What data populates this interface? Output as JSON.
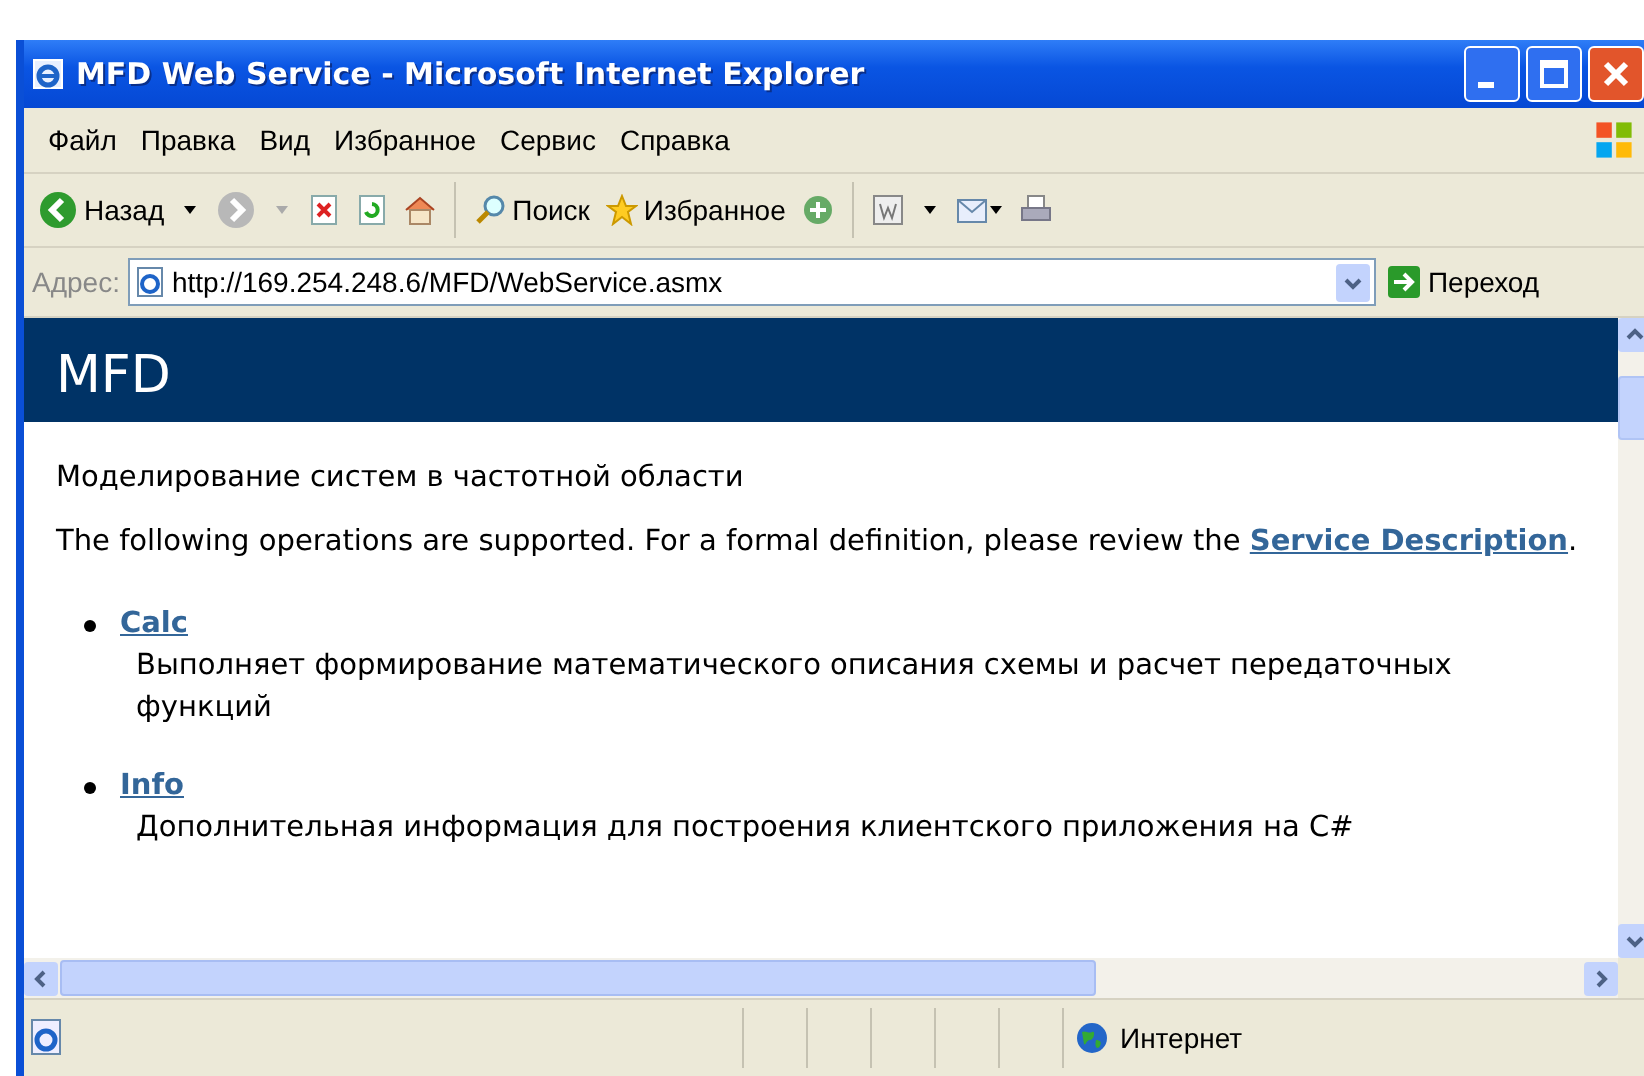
{
  "window": {
    "title": "MFD Web Service - Microsoft Internet Explorer"
  },
  "menu": [
    "Файл",
    "Правка",
    "Вид",
    "Избранное",
    "Сервис",
    "Справка"
  ],
  "toolbar": {
    "back": "Назад",
    "search": "Поиск",
    "favorites": "Избранное"
  },
  "address": {
    "label": "Адрес:",
    "value": "http://169.254.248.6/MFD/WebService.asmx",
    "go": "Переход"
  },
  "page": {
    "heading": "MFD",
    "description": "Моделирование систем в частотной области",
    "intro": "The following operations are supported. For a formal definition, please review the ",
    "intro_link": "Service Description",
    "intro_end": ".",
    "operations": [
      {
        "name": "Calc",
        "description": "Выполняет формирование математического описания схемы и расчет передаточных функций"
      },
      {
        "name": "Info",
        "description": "Дополнительная информация для построения клиентского приложения на C#"
      }
    ]
  },
  "status_bar": {
    "zone": "Интернет"
  }
}
